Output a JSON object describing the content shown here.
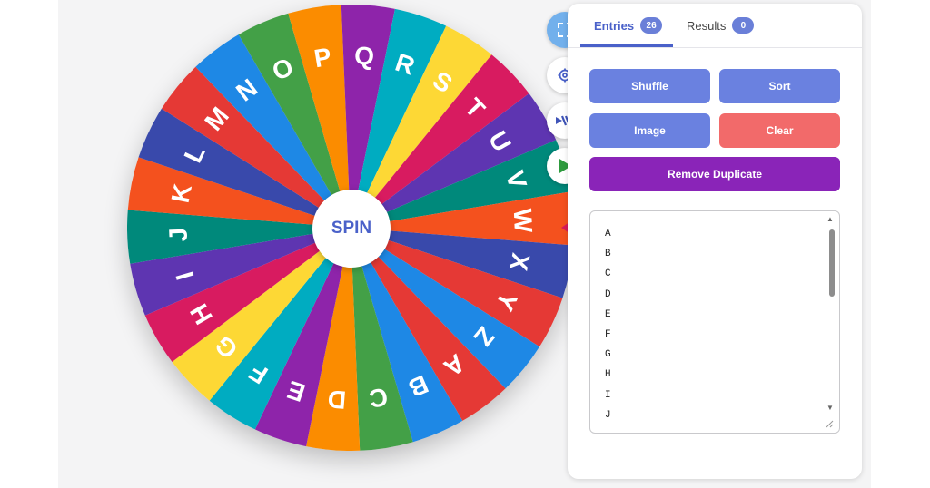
{
  "wheel": {
    "spin_label": "SPIN",
    "segments": [
      {
        "letter": "A",
        "color": "#e53935"
      },
      {
        "letter": "B",
        "color": "#1e88e5"
      },
      {
        "letter": "C",
        "color": "#43a047"
      },
      {
        "letter": "D",
        "color": "#fb8c00"
      },
      {
        "letter": "E",
        "color": "#8e24aa"
      },
      {
        "letter": "F",
        "color": "#00acc1"
      },
      {
        "letter": "G",
        "color": "#fdd835"
      },
      {
        "letter": "H",
        "color": "#d81b60"
      },
      {
        "letter": "I",
        "color": "#5e35b1"
      },
      {
        "letter": "J",
        "color": "#00897b"
      },
      {
        "letter": "K",
        "color": "#f4511e"
      },
      {
        "letter": "L",
        "color": "#3949ab"
      },
      {
        "letter": "M",
        "color": "#e53935"
      },
      {
        "letter": "N",
        "color": "#1e88e5"
      },
      {
        "letter": "O",
        "color": "#43a047"
      },
      {
        "letter": "P",
        "color": "#fb8c00"
      },
      {
        "letter": "Q",
        "color": "#8e24aa"
      },
      {
        "letter": "R",
        "color": "#00acc1"
      },
      {
        "letter": "S",
        "color": "#fdd835"
      },
      {
        "letter": "T",
        "color": "#d81b60"
      },
      {
        "letter": "U",
        "color": "#5e35b1"
      },
      {
        "letter": "V",
        "color": "#00897b"
      },
      {
        "letter": "W",
        "color": "#f4511e"
      },
      {
        "letter": "X",
        "color": "#3949ab"
      },
      {
        "letter": "Y",
        "color": "#e53935"
      },
      {
        "letter": "Z",
        "color": "#1e88e5"
      }
    ],
    "pointer_color": "#d81b5a"
  },
  "sidebar_icons": [
    {
      "name": "fullscreen-icon"
    },
    {
      "name": "settings-icon"
    },
    {
      "name": "share-icon"
    },
    {
      "name": "play-icon"
    }
  ],
  "tabs": {
    "entries": {
      "label": "Entries",
      "count": "26"
    },
    "results": {
      "label": "Results",
      "count": "0"
    }
  },
  "buttons": {
    "shuffle": "Shuffle",
    "sort": "Sort",
    "image": "Image",
    "clear": "Clear",
    "remove_duplicate": "Remove Duplicate"
  },
  "entries": [
    "A",
    "B",
    "C",
    "D",
    "E",
    "F",
    "G",
    "H",
    "I",
    "J"
  ],
  "colors": {
    "accent": "#4a61c9",
    "button_blue": "#6a81e0",
    "button_red": "#f26a6a",
    "button_purple": "#8a24b8"
  }
}
